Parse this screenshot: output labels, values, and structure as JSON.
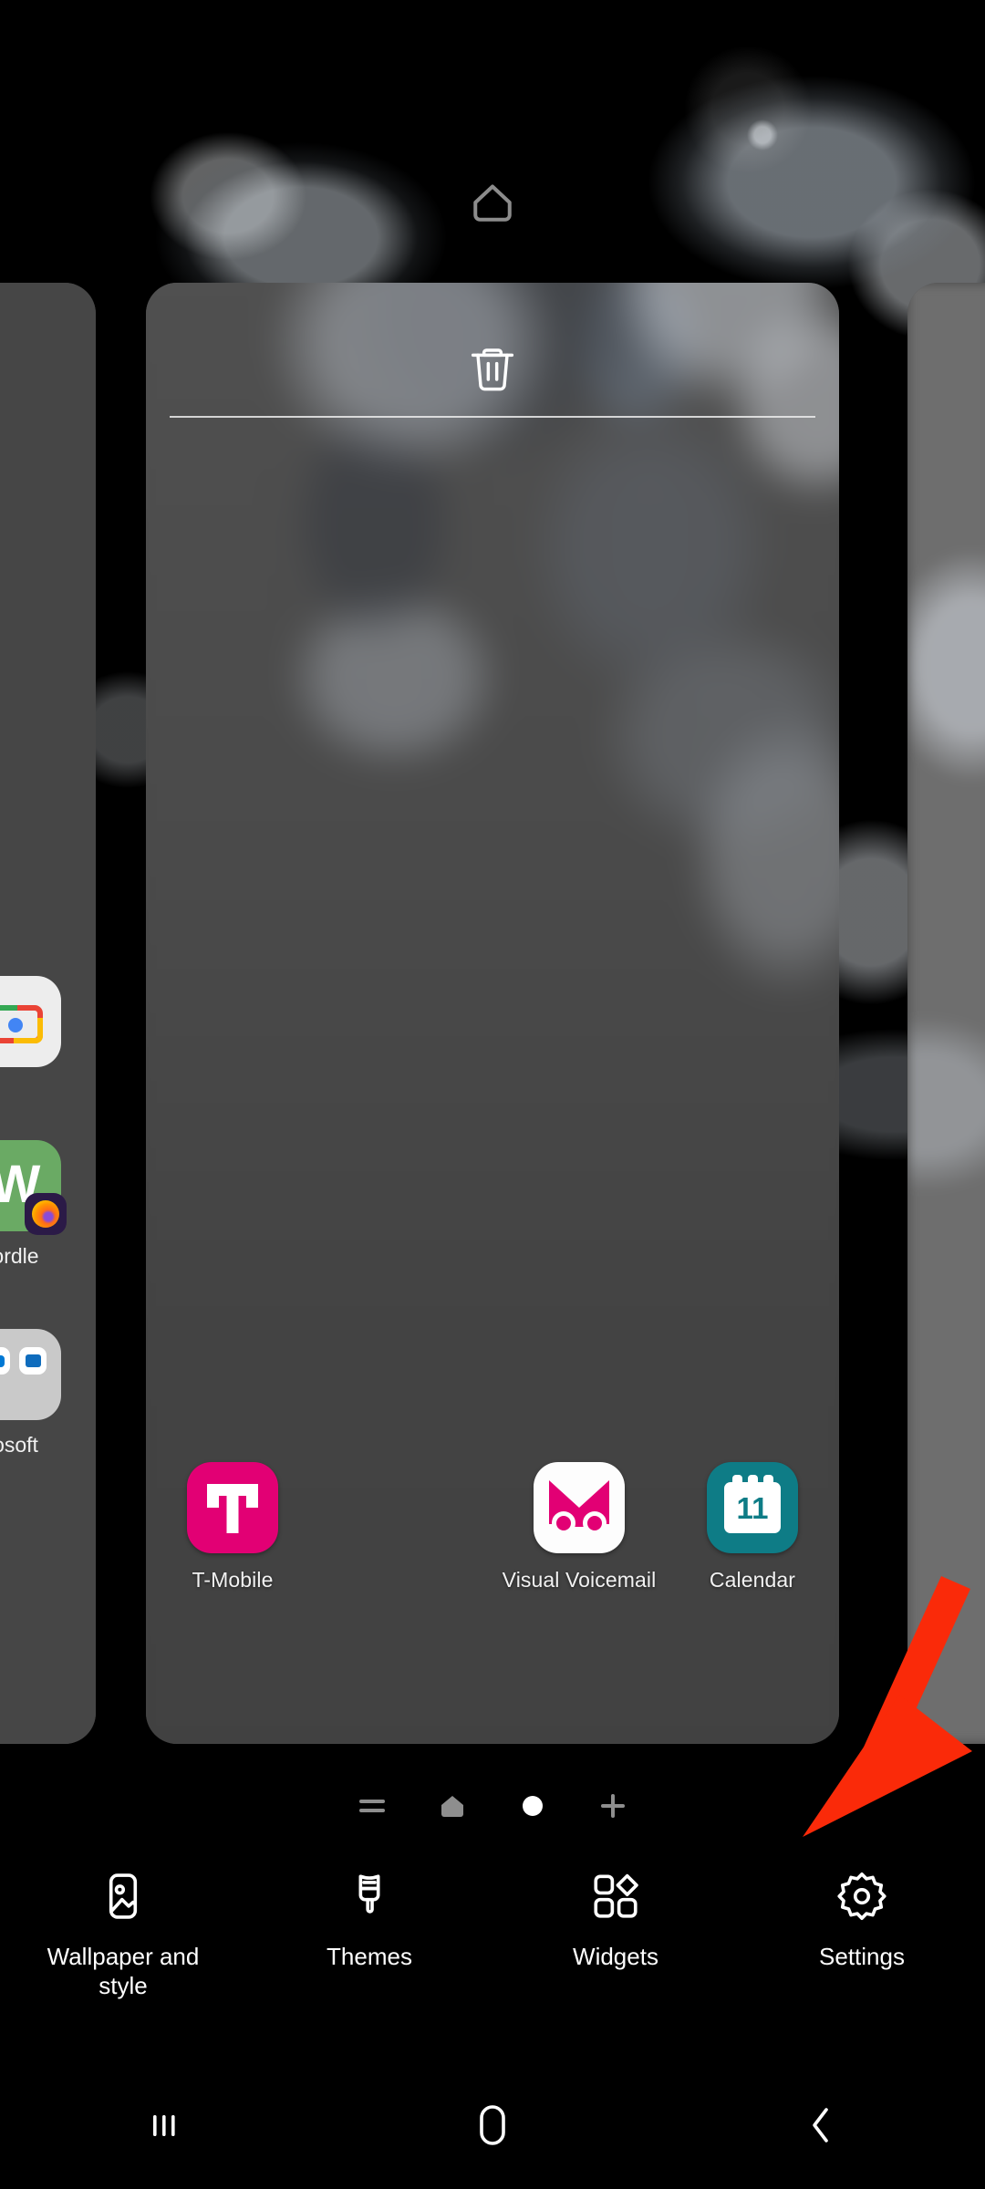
{
  "screen": {
    "type": "android-home-screen-edit-mode",
    "background_color": "#000000"
  },
  "home_indicator": {
    "icon": "home-outline-icon",
    "color": "#8c8c8c"
  },
  "active_page_card": {
    "background_color": "#474747",
    "delete_icon": "trash-icon",
    "delete_label": "Remove page",
    "dock": [
      {
        "label": "T-Mobile",
        "icon": "t-mobile-icon",
        "color": "#E20074"
      },
      {
        "label": "",
        "icon": "empty-slot",
        "color": ""
      },
      {
        "label": "Visual Voicemail",
        "icon": "visual-voicemail-icon",
        "color": "#E20074"
      },
      {
        "label": "Calendar",
        "icon": "calendar-icon",
        "color": "#0E7C86",
        "day": "11"
      }
    ]
  },
  "left_apps": [
    {
      "label": "",
      "icon": "photos-camera-icon"
    },
    {
      "label": "ordle",
      "icon": "wordle-icon",
      "badge": "firefox-icon"
    },
    {
      "label": "osoft",
      "icon": "microsoft-folder-icon"
    }
  ],
  "page_indicators": [
    {
      "name": "app-list-page",
      "icon": "lines-icon",
      "active": false
    },
    {
      "name": "home-page",
      "icon": "home-icon",
      "active": false
    },
    {
      "name": "current-page",
      "icon": "dot-icon",
      "active": true
    },
    {
      "name": "add-page",
      "icon": "plus-icon",
      "active": false
    }
  ],
  "option_bar": [
    {
      "label": "Wallpaper and style",
      "icon": "wallpaper-icon"
    },
    {
      "label": "Themes",
      "icon": "paintbrush-icon"
    },
    {
      "label": "Widgets",
      "icon": "widgets-icon"
    },
    {
      "label": "Settings",
      "icon": "gear-icon"
    }
  ],
  "nav_bar": [
    {
      "name": "recents",
      "icon": "recents-icon"
    },
    {
      "name": "home",
      "icon": "home-pill-icon"
    },
    {
      "name": "back",
      "icon": "back-chevron-icon"
    }
  ],
  "annotation": {
    "type": "arrow",
    "color": "#FA2A09",
    "points_to": "Settings"
  }
}
